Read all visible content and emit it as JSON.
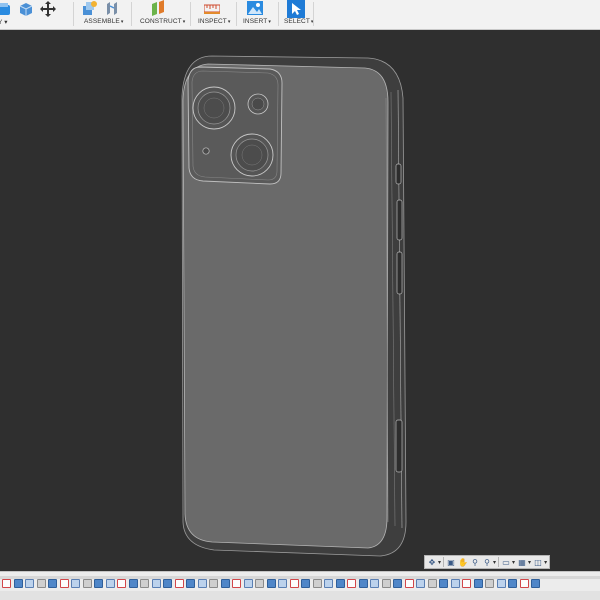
{
  "toolbar": {
    "groups": [
      {
        "label": "",
        "id": "create"
      },
      {
        "label": "ASSEMBLE",
        "id": "assemble"
      },
      {
        "label": "CONSTRUCT",
        "id": "construct"
      },
      {
        "label": "INSPECT",
        "id": "inspect"
      },
      {
        "label": "INSERT",
        "id": "insert"
      },
      {
        "label": "SELECT",
        "id": "select"
      }
    ],
    "partial_caret": "Y ▾"
  },
  "icons": {
    "create": [
      "extrude-icon",
      "box-icon",
      "move-icon"
    ],
    "assemble": [
      "new-component-icon",
      "joint-icon"
    ],
    "construct": [
      "offset-plane-icon"
    ],
    "inspect": [
      "measure-icon"
    ],
    "insert": [
      "insert-image-icon"
    ],
    "select": [
      "select-cursor-icon"
    ]
  },
  "navbar": {
    "items": [
      "orbit-icon",
      "look-at-icon",
      "pan-icon",
      "zoom-icon",
      "zoom-window-icon",
      "display-settings-icon",
      "grid-icon",
      "viewports-icon"
    ]
  },
  "colors": {
    "accent": "#1f7bd6",
    "viewport": "#2f2f2f",
    "ribbon": "#f2f2f2"
  }
}
